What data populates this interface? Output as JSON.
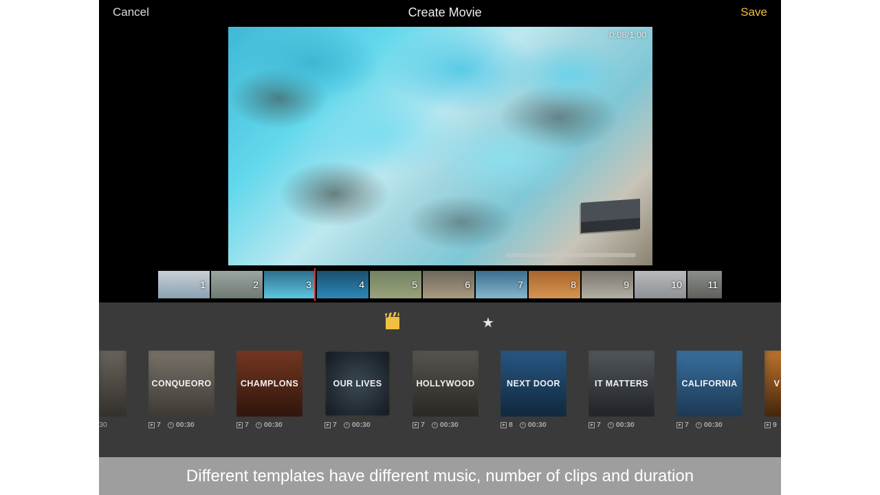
{
  "nav": {
    "cancel": "Cancel",
    "title": "Create Movie",
    "save": "Save"
  },
  "preview": {
    "timestamp": "0:08/1:00"
  },
  "timeline": {
    "clips": [
      {
        "n": "1"
      },
      {
        "n": "2"
      },
      {
        "n": "3"
      },
      {
        "n": "4"
      },
      {
        "n": "5"
      },
      {
        "n": "6"
      },
      {
        "n": "7"
      },
      {
        "n": "8"
      },
      {
        "n": "9"
      },
      {
        "n": "10"
      },
      {
        "n": "11"
      }
    ]
  },
  "templates": [
    {
      "label": "",
      "clips": "",
      "duration": "30"
    },
    {
      "label": "CONQUEORO",
      "clips": "7",
      "duration": "00:30"
    },
    {
      "label": "CHAMPLONS",
      "clips": "7",
      "duration": "00:30"
    },
    {
      "label": "OUR LIVES",
      "clips": "7",
      "duration": "00:30"
    },
    {
      "label": "HOLLYWOOD",
      "clips": "7",
      "duration": "00:30"
    },
    {
      "label": "NEXT DOOR",
      "clips": "8",
      "duration": "00:30"
    },
    {
      "label": "IT MATTERS",
      "clips": "7",
      "duration": "00:30"
    },
    {
      "label": "CALIFORNIA",
      "clips": "7",
      "duration": "00:30"
    },
    {
      "label": "V",
      "clips": "9",
      "duration": ""
    }
  ],
  "caption": "Different templates have different music, number of clips and duration"
}
